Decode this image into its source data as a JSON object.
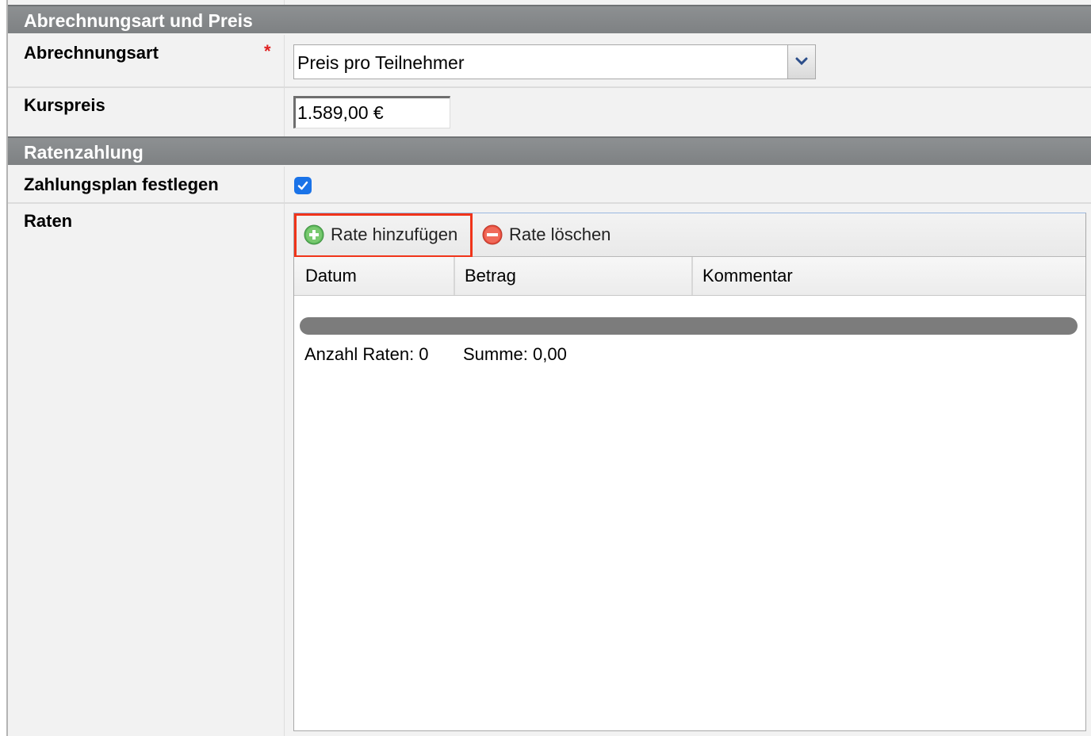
{
  "section1": {
    "title": "Abrechnungsart und Preis"
  },
  "abrechnungsart": {
    "label": "Abrechnungsart",
    "required_marker": "*",
    "selected_value": "Preis pro Teilnehmer"
  },
  "kurspreis": {
    "label": "Kurspreis",
    "value": "1.589,00 €"
  },
  "section2": {
    "title": "Ratenzahlung"
  },
  "zahlungsplan": {
    "label": "Zahlungsplan festlegen",
    "checked": true
  },
  "raten": {
    "label": "Raten",
    "toolbar": {
      "add_label": "Rate hinzufügen",
      "delete_label": "Rate löschen"
    },
    "columns": [
      "Datum",
      "Betrag",
      "Kommentar"
    ],
    "footer": {
      "count_label": "Anzahl Raten: 0",
      "sum_label": "Summe: 0,00"
    }
  },
  "colors": {
    "header_bg": "#888b8d",
    "highlight": "#f0341a",
    "checkbox": "#1a73e8",
    "add_icon": "#5cb85c",
    "delete_icon": "#e74c3c"
  }
}
